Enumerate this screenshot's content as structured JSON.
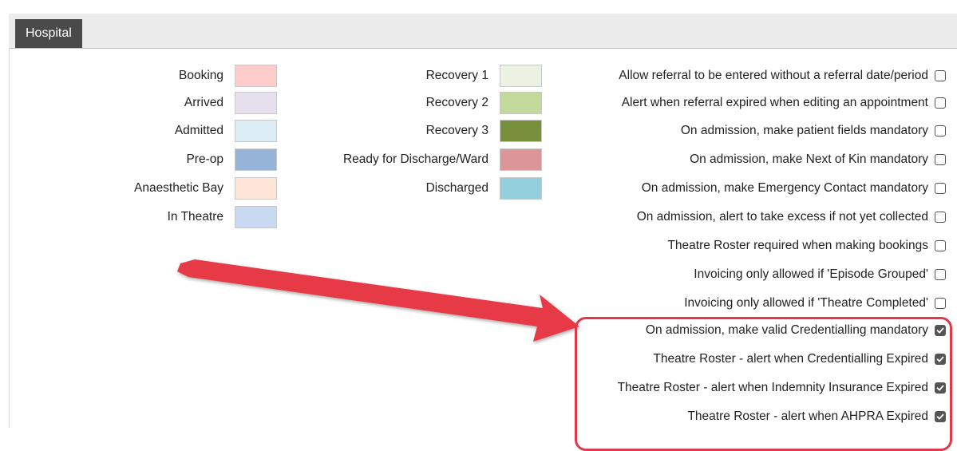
{
  "tab": {
    "label": "Hospital"
  },
  "colors_col1": [
    {
      "label": "Booking",
      "color": "#ffcccc"
    },
    {
      "label": "Arrived",
      "color": "#e6e0ee"
    },
    {
      "label": "Admitted",
      "color": "#dcedf5"
    },
    {
      "label": "Pre-op",
      "color": "#95b4d8"
    },
    {
      "label": "Anaesthetic Bay",
      "color": "#fde6d8"
    },
    {
      "label": "In Theatre",
      "color": "#c9d9f1"
    }
  ],
  "colors_col2": [
    {
      "label": "Recovery 1",
      "color": "#ebf2e1"
    },
    {
      "label": "Recovery 2",
      "color": "#c3d89b"
    },
    {
      "label": "Recovery 3",
      "color": "#788f3c"
    },
    {
      "label": "Ready for Discharge/Ward",
      "color": "#dd9697"
    },
    {
      "label": "Discharged",
      "color": "#93cfdc"
    }
  ],
  "options": [
    {
      "label": "Allow referral to be entered without a referral date/period",
      "checked": false
    },
    {
      "label": "Alert when referral expired when editing an appointment",
      "checked": false
    },
    {
      "label": "On admission, make patient fields mandatory",
      "checked": false
    },
    {
      "label": "On admission, make Next of Kin mandatory",
      "checked": false
    },
    {
      "label": "On admission, make Emergency Contact mandatory",
      "checked": false
    },
    {
      "label": "On admission, alert to take excess if not yet collected",
      "checked": false
    },
    {
      "label": "Theatre Roster required when making bookings",
      "checked": false
    },
    {
      "label": "Invoicing only allowed if 'Episode Grouped'",
      "checked": false
    },
    {
      "label": "Invoicing only allowed if 'Theatre Completed'",
      "checked": false
    },
    {
      "label": "On admission, make valid Credentialling mandatory",
      "checked": true
    },
    {
      "label": "Theatre Roster - alert when Credentialling Expired",
      "checked": true
    },
    {
      "label": "Theatre Roster - alert when Indemnity Insurance Expired",
      "checked": true
    },
    {
      "label": "Theatre Roster - alert when AHPRA Expired",
      "checked": true
    }
  ],
  "annotation": {
    "color": "#e0394a"
  }
}
